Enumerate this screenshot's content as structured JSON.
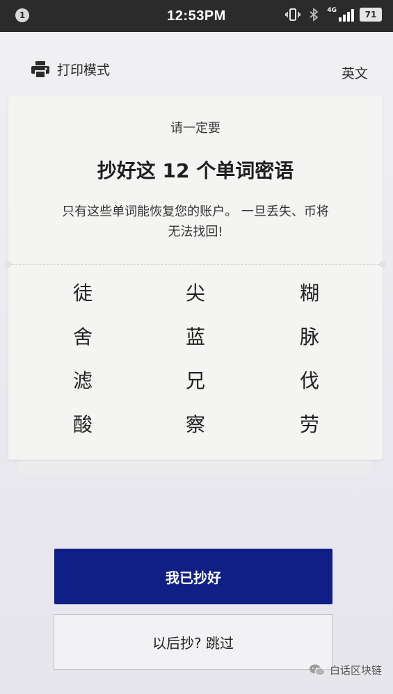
{
  "status_bar": {
    "notification_count": "1",
    "time": "12:53PM",
    "network_label": "4G",
    "battery": "71",
    "icons": [
      "vibrate-icon",
      "bluetooth-icon",
      "signal-icon",
      "battery-icon"
    ]
  },
  "header": {
    "print_mode_label": "打印模式",
    "print_icon": "printer-icon",
    "language_toggle": "英文"
  },
  "card": {
    "subtitle": "请一定要",
    "title": "抄好这 12 个单词密语",
    "description": "只有这些单词能恢复您的账户。 一旦丢失、币将无法找回!",
    "words": [
      "徒",
      "尖",
      "糊",
      "舍",
      "蓝",
      "脉",
      "滤",
      "兄",
      "伐",
      "酸",
      "察",
      "劳"
    ]
  },
  "buttons": {
    "confirm_label": "我已抄好",
    "skip_label": "以后抄? 跳过"
  },
  "watermark": {
    "text": "白话区块链"
  },
  "colors": {
    "primary_button": "#0f1f86",
    "status_bar": "#2b2b2b",
    "card_bg": "#f4f4f2"
  }
}
